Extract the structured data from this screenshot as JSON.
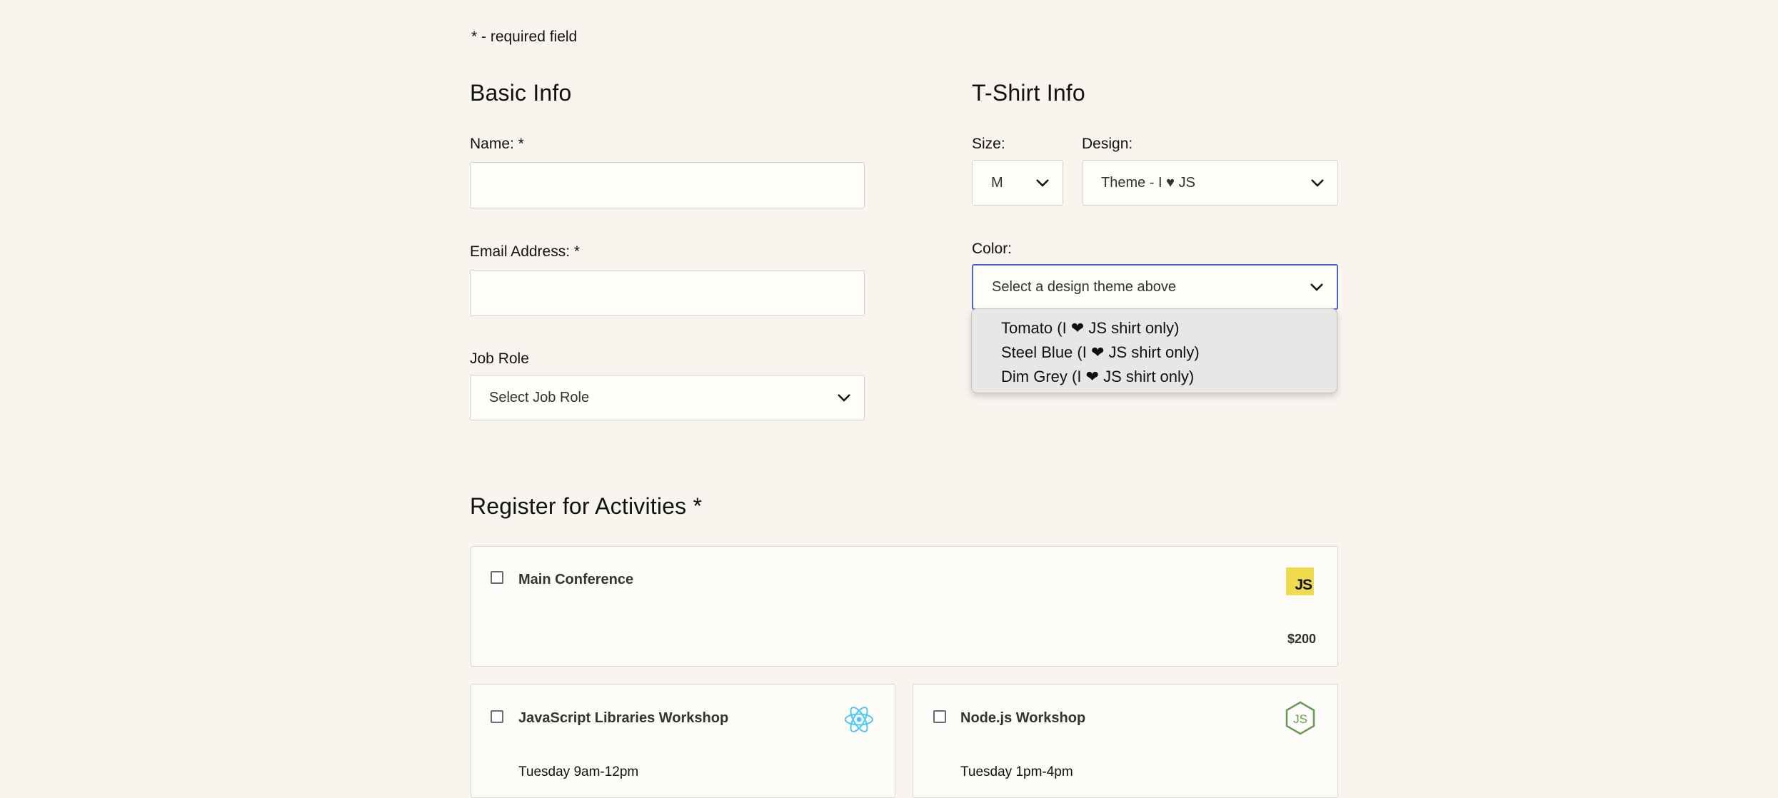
{
  "required_note": "* - required field",
  "basic_info": {
    "heading": "Basic Info",
    "name_label": "Name: *",
    "name_value": "",
    "email_label": "Email Address: *",
    "email_value": "",
    "job_role_label": "Job Role",
    "job_role_selected": "Select Job Role"
  },
  "tshirt_info": {
    "heading": "T-Shirt Info",
    "size_label": "Size:",
    "size_selected": "M",
    "design_label": "Design:",
    "design_selected": "Theme - I ♥ JS",
    "color_label": "Color:",
    "color_selected": "Select a design theme above",
    "color_options": [
      "Tomato (I ❤ JS shirt only)",
      "Steel Blue (I ❤ JS shirt only)",
      "Dim Grey (I ❤ JS shirt only)"
    ]
  },
  "activities": {
    "heading": "Register for Activities *",
    "main": {
      "title": "Main Conference",
      "price": "$200",
      "icon": "js-icon",
      "checked": false
    },
    "items": [
      {
        "title": "JavaScript Libraries Workshop",
        "time": "Tuesday 9am-12pm",
        "icon": "react-icon",
        "checked": false
      },
      {
        "title": "Node.js Workshop",
        "time": "Tuesday 1pm-4pm",
        "icon": "nodejs-icon",
        "checked": false
      }
    ]
  },
  "colors": {
    "background": "#f8f5ef",
    "focus_border": "#4a63d8",
    "js_yellow": "#f0db4f",
    "react_blue": "#4ec9f5",
    "node_green": "#6a9a58"
  }
}
